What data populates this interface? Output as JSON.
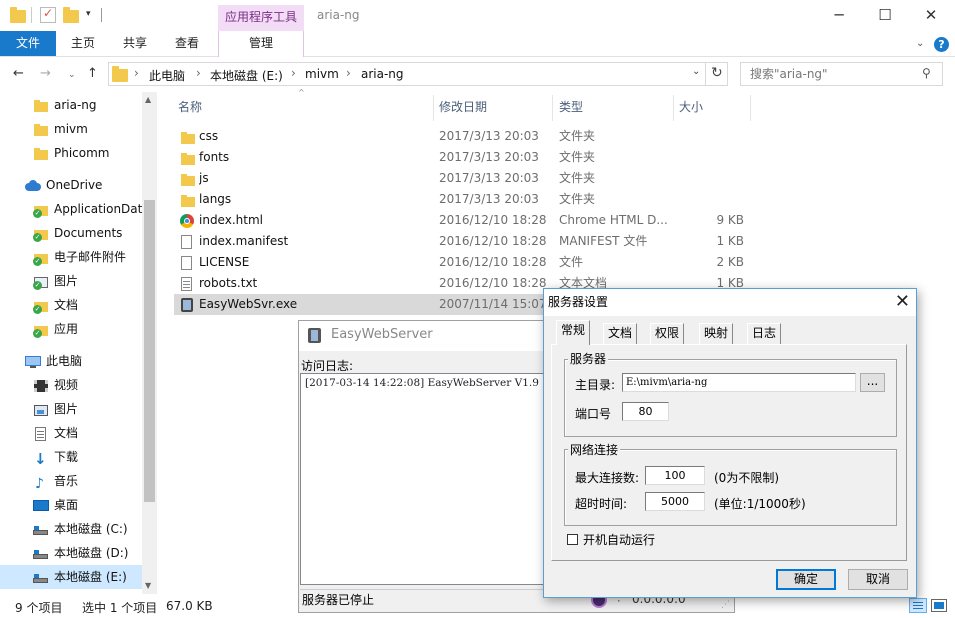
{
  "titlebar": {
    "context_tab": "应用程序工具",
    "title": "aria-ng",
    "minimize_glyph": "─",
    "maximize_glyph": "☐",
    "close_glyph": "✕"
  },
  "ribbon": {
    "file": "文件",
    "home": "主页",
    "share": "共享",
    "view": "查看",
    "manage": "管理"
  },
  "address": {
    "crumbs": [
      "此电脑",
      "本地磁盘 (E:)",
      "mivm",
      "aria-ng"
    ],
    "search_placeholder": "搜索\"aria-ng\""
  },
  "navpane": {
    "items": [
      {
        "label": "aria-ng",
        "icon": "folder-icon"
      },
      {
        "label": "mivm",
        "icon": "folder-icon"
      },
      {
        "label": "Phicomm",
        "icon": "folder-icon"
      },
      {
        "label": "OneDrive",
        "icon": "onedrive-icon"
      },
      {
        "label": "ApplicationData",
        "icon": "synced-folder-icon"
      },
      {
        "label": "Documents",
        "icon": "synced-folder-icon"
      },
      {
        "label": "电子邮件附件",
        "icon": "synced-folder-icon"
      },
      {
        "label": "图片",
        "icon": "synced-pictures-icon"
      },
      {
        "label": "文档",
        "icon": "synced-folder-icon"
      },
      {
        "label": "应用",
        "icon": "synced-folder-icon"
      },
      {
        "label": "此电脑",
        "icon": "computer-icon"
      },
      {
        "label": "视频",
        "icon": "video-icon"
      },
      {
        "label": "图片",
        "icon": "pictures-icon"
      },
      {
        "label": "文档",
        "icon": "documents-icon"
      },
      {
        "label": "下载",
        "icon": "download-icon"
      },
      {
        "label": "音乐",
        "icon": "music-icon"
      },
      {
        "label": "桌面",
        "icon": "desktop-icon"
      },
      {
        "label": "本地磁盘 (C:)",
        "icon": "drive-icon"
      },
      {
        "label": "本地磁盘 (D:)",
        "icon": "drive-icon"
      },
      {
        "label": "本地磁盘 (E:)",
        "icon": "drive-icon"
      }
    ]
  },
  "filelist": {
    "columns": {
      "name": "名称",
      "date": "修改日期",
      "type": "类型",
      "size": "大小"
    },
    "rows": [
      {
        "name": "css",
        "date": "2017/3/13 20:03",
        "type": "文件夹",
        "size": "",
        "icon": "folder-icon"
      },
      {
        "name": "fonts",
        "date": "2017/3/13 20:03",
        "type": "文件夹",
        "size": "",
        "icon": "folder-icon"
      },
      {
        "name": "js",
        "date": "2017/3/13 20:03",
        "type": "文件夹",
        "size": "",
        "icon": "folder-icon"
      },
      {
        "name": "langs",
        "date": "2017/3/13 20:03",
        "type": "文件夹",
        "size": "",
        "icon": "folder-icon"
      },
      {
        "name": "index.html",
        "date": "2016/12/10 18:28",
        "type": "Chrome HTML D...",
        "size": "9 KB",
        "icon": "chrome-icon"
      },
      {
        "name": "index.manifest",
        "date": "2016/12/10 18:28",
        "type": "MANIFEST 文件",
        "size": "1 KB",
        "icon": "file-icon"
      },
      {
        "name": "LICENSE",
        "date": "2016/12/10 18:28",
        "type": "文件",
        "size": "2 KB",
        "icon": "file-icon"
      },
      {
        "name": "robots.txt",
        "date": "2016/12/10 18:28",
        "type": "文本文档",
        "size": "1 KB",
        "icon": "text-file-icon"
      },
      {
        "name": "EasyWebSvr.exe",
        "date": "2007/11/14 15:07",
        "type": "",
        "size": "",
        "icon": "exe-icon"
      }
    ]
  },
  "status": {
    "count": "9 个项目",
    "selected": "选中 1 个项目",
    "size": "67.0 KB"
  },
  "ews": {
    "title": "EasyWebServer",
    "log_label": "访问日志:",
    "log_line": "[2017-03-14 14:22:08] EasyWebServer V1.9",
    "status": "服务器已停止",
    "address": "0.0.0.0:0"
  },
  "dialog": {
    "title": "服务器设置",
    "tabs": [
      "常规",
      "文档",
      "权限",
      "映射",
      "日志"
    ],
    "server_group": "服务器",
    "root_label": "主目录:",
    "root_value": "E:\\mivm\\aria-ng",
    "browse": "...",
    "port_label": "端口号",
    "port_value": "80",
    "net_group": "网络连接",
    "maxconn_label": "最大连接数:",
    "maxconn_value": "100",
    "maxconn_hint": "(0为不限制)",
    "timeout_label": "超时时间:",
    "timeout_value": "5000",
    "timeout_hint": "(单位:1/1000秒)",
    "autorun_label": "开机自动运行",
    "ok": "确定",
    "cancel": "取消"
  },
  "colors": {
    "accent": "#1979ca",
    "context_tab_bg": "#f2dcf6",
    "selection": "#cde8ff",
    "folder": "#f2c94c"
  }
}
